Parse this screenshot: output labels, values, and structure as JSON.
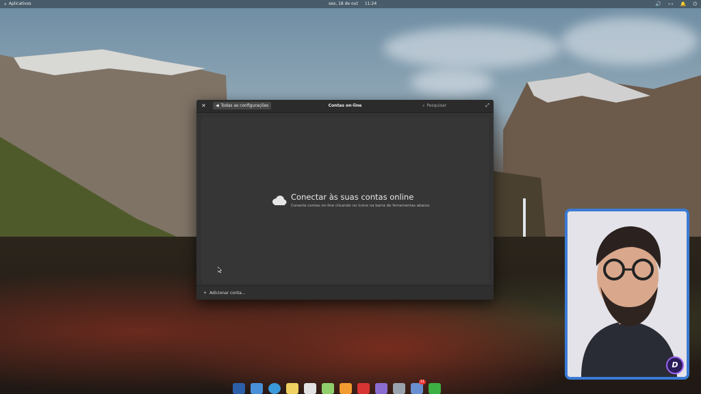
{
  "panel": {
    "apps_label": "Aplicativos",
    "date": "sex, 18 de out",
    "time": "11:24"
  },
  "window": {
    "close_icon": "close-icon",
    "back_label": "Todas as configurações",
    "title": "Contas on-line",
    "search_placeholder": "Pesquisar",
    "placeholder_title": "Conectar às suas contas online",
    "placeholder_desc": "Conecte contas on-line clicando no ícone na barra de ferramentas abaixo.",
    "add_account_label": "Adicionar conta..."
  },
  "dock": {
    "items": [
      "multitasking",
      "files",
      "browser",
      "mail",
      "tasks",
      "spreadsheet",
      "music",
      "videos",
      "photos",
      "settings",
      "appcenter",
      "checklist"
    ],
    "appcenter_badge": "11"
  },
  "colors": {
    "window_bg": "#333333",
    "webcam_border": "#3a7bd5"
  }
}
